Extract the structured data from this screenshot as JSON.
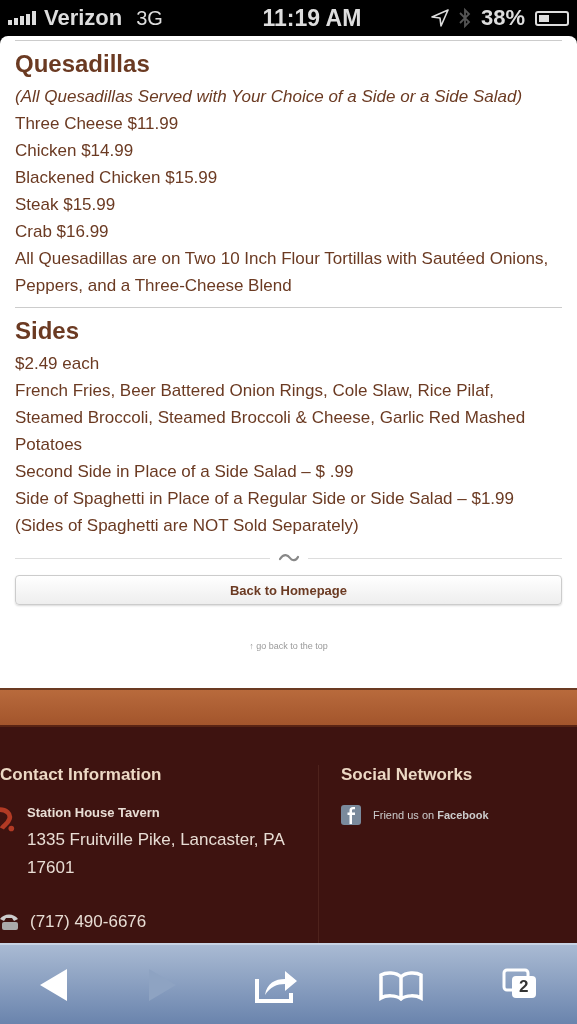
{
  "status_bar": {
    "carrier": "Verizon",
    "network": "3G",
    "time": "11:19 AM",
    "battery": "38%"
  },
  "sections": [
    {
      "title": "Quesadillas",
      "lines": [
        {
          "kind": "note",
          "text": "(All Quesadillas Served with Your Choice of a Side or a Side Salad)"
        },
        {
          "kind": "text",
          "text": "Three Cheese $11.99"
        },
        {
          "kind": "text",
          "text": "Chicken $14.99"
        },
        {
          "kind": "text",
          "text": "Blackened Chicken $15.99"
        },
        {
          "kind": "text",
          "text": "Steak $15.99"
        },
        {
          "kind": "text",
          "text": "Crab $16.99"
        },
        {
          "kind": "text",
          "text": "All Quesadillas are on Two 10 Inch Flour Tortillas with Sautéed Onions, Peppers, and a Three-Cheese Blend"
        }
      ]
    },
    {
      "title": "Sides",
      "lines": [
        {
          "kind": "text",
          "text": "$2.49 each"
        },
        {
          "kind": "text",
          "text": "French Fries, Beer Battered Onion Rings, Cole Slaw, Rice Pilaf, Steamed Broccoli, Steamed Broccoli & Cheese, Garlic Red Mashed Potatoes"
        },
        {
          "kind": "text",
          "text": "Second Side in Place of a Side Salad – $ .99"
        },
        {
          "kind": "text",
          "text": "Side of Spaghetti in Place of a Regular Side or Side Salad – $1.99"
        },
        {
          "kind": "text",
          "text": "(Sides of Spaghetti are NOT Sold Separately)"
        }
      ]
    }
  ],
  "back_button": "Back to Homepage",
  "back_to_top": "↑ go back to the top",
  "footer": {
    "contact": {
      "title": "Contact Information",
      "name": "Station House Tavern",
      "address": "1335 Fruitville Pike, Lancaster, PA 17601",
      "phone": "(717) 490-6676"
    },
    "social": {
      "title": "Social Networks",
      "link": "Friend us on **Facebook**"
    }
  },
  "toolbar": {
    "back_disabled": false,
    "forward_disabled": true,
    "tab_count": "2"
  }
}
